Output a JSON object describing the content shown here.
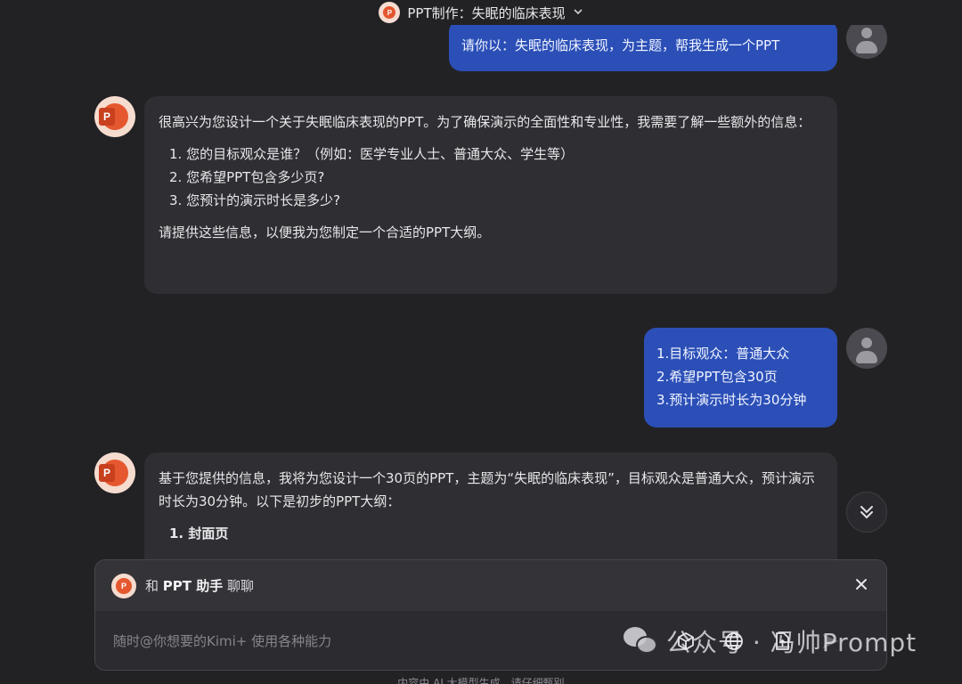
{
  "header": {
    "title": "PPT制作：失眠的临床表现",
    "chevron_icon": "chevron-down-icon"
  },
  "messages": {
    "user_1": "请你以：失眠的临床表现，为主题，帮我生成一个PPT",
    "ai_1": {
      "intro": "很高兴为您设计一个关于失眠临床表现的PPT。为了确保演示的全面性和专业性，我需要了解一些额外的信息：",
      "items": [
        "1. 您的目标观众是谁？（例如：医学专业人士、普通大众、学生等）",
        "2. 您希望PPT包含多少页?",
        "3. 您预计的演示时长是多少?"
      ],
      "outro": "请提供这些信息，以便我为您制定一个合适的PPT大纲。"
    },
    "user_2": {
      "lines": [
        "1.目标观众：普通大众",
        "2.希望PPT包含30页",
        "3.预计演示时长为30分钟"
      ]
    },
    "ai_2": {
      "intro": "基于您提供的信息，我将为您设计一个30页的PPT，主题为“失眠的临床表现”，目标观众是普通大众，预计演示时长为30分钟。以下是初步的PPT大纲：",
      "item_1": "1. 封面页"
    }
  },
  "composer": {
    "prefix": "和",
    "assistant_name": "PPT 助手",
    "suffix": "聊聊",
    "placeholder": "随时@你想要的Kimi+ 使用各种能力",
    "tools": [
      "cube-icon",
      "globe-icon",
      "file-upload-icon",
      "send-icon"
    ]
  },
  "watermark": {
    "text": "公众号 · 冯帅Prompt"
  },
  "footer": {
    "text": "内容由 AI 大模型生成，请仔细甄别"
  },
  "colors": {
    "background": "#222225",
    "user_bubble": "#2b4fb7",
    "ai_bubble": "#2e2e33",
    "brand": "#e5582f"
  }
}
